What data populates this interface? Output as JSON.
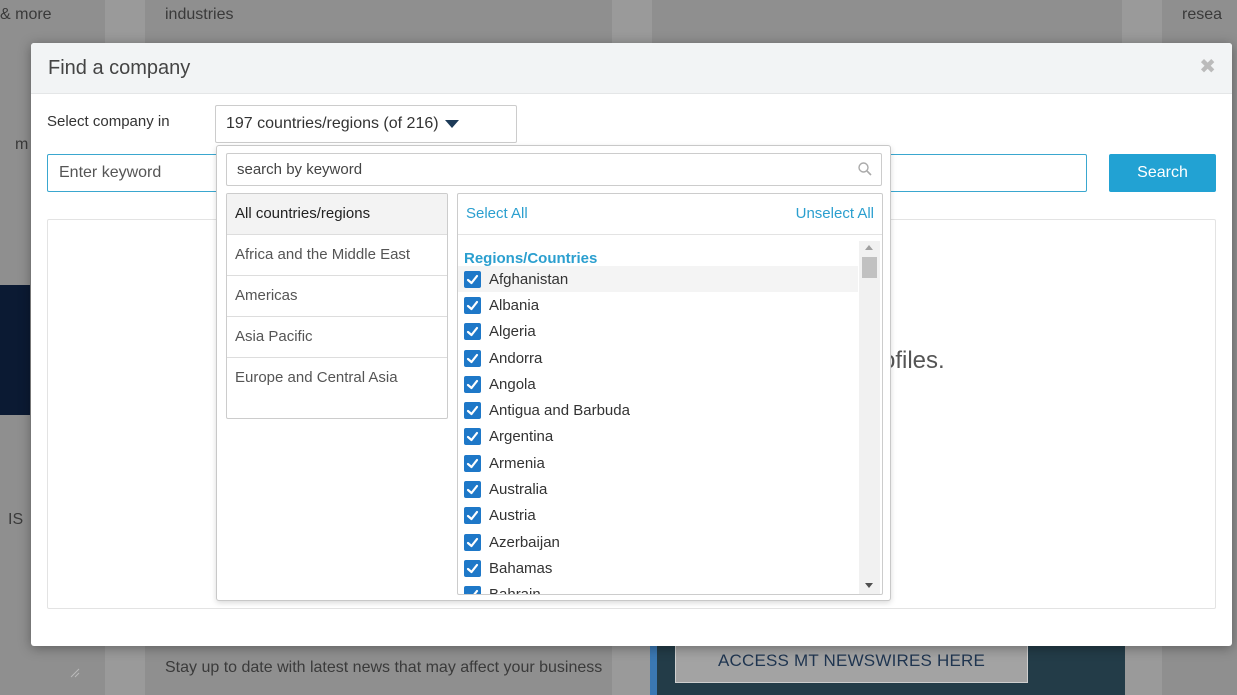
{
  "background": {
    "top_texts": [
      "& more",
      "industries",
      "resea"
    ],
    "side_texts": [
      "m",
      "IS"
    ],
    "newsletter_text": "Stay up to date with latest news that may affect your business",
    "access_button_label": "ACCESS MT NEWSWIRES HERE"
  },
  "modal": {
    "title": "Find a company",
    "select_label": "Select company in",
    "country_select_value": "197 countries/regions (of 216)",
    "keyword_placeholder": "Enter keyword",
    "search_button_label": "Search",
    "empty_message": "ofiles."
  },
  "dropdown": {
    "search_placeholder": "search by keyword",
    "regions": [
      {
        "label": "All countries/regions",
        "active": true
      },
      {
        "label": "Africa and the Middle East",
        "active": false
      },
      {
        "label": "Americas",
        "active": false
      },
      {
        "label": "Asia Pacific",
        "active": false
      },
      {
        "label": "Europe and Central Asia",
        "active": false
      }
    ],
    "select_all_label": "Select All",
    "unselect_all_label": "Unselect All",
    "list_heading": "Regions/Countries",
    "countries": [
      {
        "label": "Afghanistan",
        "checked": true
      },
      {
        "label": "Albania",
        "checked": true
      },
      {
        "label": "Algeria",
        "checked": true
      },
      {
        "label": "Andorra",
        "checked": true
      },
      {
        "label": "Angola",
        "checked": true
      },
      {
        "label": "Antigua and Barbuda",
        "checked": true
      },
      {
        "label": "Argentina",
        "checked": true
      },
      {
        "label": "Armenia",
        "checked": true
      },
      {
        "label": "Australia",
        "checked": true
      },
      {
        "label": "Austria",
        "checked": true
      },
      {
        "label": "Azerbaijan",
        "checked": true
      },
      {
        "label": "Bahamas",
        "checked": true
      },
      {
        "label": "Bahrain",
        "checked": true
      }
    ]
  },
  "colors": {
    "accent": "#22a2d3",
    "link": "#2b9fcf",
    "checkbox": "#1e78c8"
  }
}
